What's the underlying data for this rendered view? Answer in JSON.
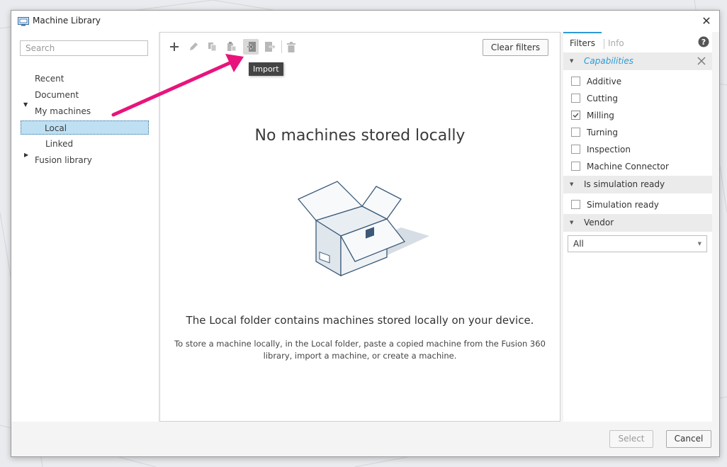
{
  "window": {
    "title": "Machine Library",
    "close_glyph": "✕"
  },
  "tree": {
    "search_placeholder": "Search",
    "items": [
      {
        "label": "Recent"
      },
      {
        "label": "Document"
      },
      {
        "label": "My machines"
      },
      {
        "label": "Local"
      },
      {
        "label": "Linked"
      },
      {
        "label": "Fusion library"
      }
    ],
    "selected": "Local"
  },
  "toolbar": {
    "tooltip": "Import",
    "clear_filters": "Clear filters",
    "icons": [
      "add-icon",
      "edit-icon",
      "copy-icon",
      "paste-icon",
      "import-icon",
      "export-icon",
      "delete-icon"
    ],
    "active_icon": "import-icon"
  },
  "empty_state": {
    "heading": "No machines stored locally",
    "subheading": "The Local folder contains machines stored locally on your device.",
    "description_line1": "To store a machine locally, in the Local folder, paste a copied machine from the Fusion 360",
    "description_line2": "library, import a machine, or create a machine."
  },
  "filters": {
    "tabs": [
      {
        "label": "Filters",
        "active": true
      },
      {
        "label": "Info",
        "active": false
      }
    ],
    "capabilities": {
      "title": "Capabilities",
      "options": [
        {
          "label": "Additive",
          "checked": false
        },
        {
          "label": "Cutting",
          "checked": false
        },
        {
          "label": "Milling",
          "checked": true
        },
        {
          "label": "Turning",
          "checked": false
        },
        {
          "label": "Inspection",
          "checked": false
        },
        {
          "label": "Machine Connector",
          "checked": false
        }
      ]
    },
    "simulation": {
      "title": "Is simulation ready",
      "options": [
        {
          "label": "Simulation ready",
          "checked": false
        }
      ]
    },
    "vendor": {
      "title": "Vendor",
      "selected": "All"
    }
  },
  "footer": {
    "select_label": "Select",
    "cancel_label": "Cancel"
  },
  "colors": {
    "accent": "#2d9ad6",
    "selection": "#bfe0f3",
    "annotation_arrow": "#e8147c"
  }
}
